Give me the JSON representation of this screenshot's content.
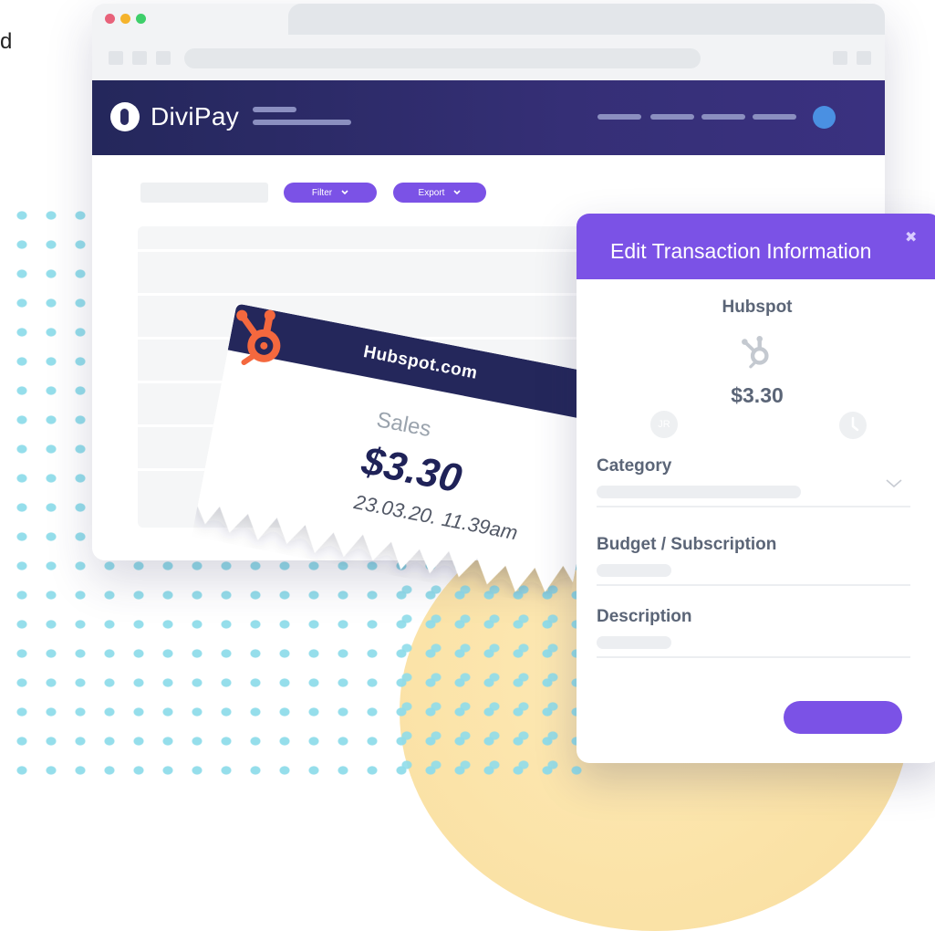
{
  "corner_text": "d",
  "colors": {
    "purple": "#7b52e6",
    "navy": "#24275b",
    "hubspot_orange": "#f4683e",
    "dot_cyan": "#8fdcea"
  },
  "window": {
    "traffic_lights": [
      "#e8627a",
      "#f5b32c",
      "#3ecf6a"
    ]
  },
  "navbar": {
    "brand": "DiviPay",
    "logo_icon": "keyhole-logo-icon",
    "avatar_color": "#4a90e2"
  },
  "toolbar": {
    "filter_label": "Filter",
    "export_label": "Export",
    "dropdown_icon": "chevron-down-icon"
  },
  "receipt": {
    "merchant_site": "Hubspot.com",
    "category": "Sales",
    "amount": "$3.30",
    "datetime": "23.03.20. 11.39am",
    "logo_icon": "hubspot-sprocket-icon"
  },
  "modal": {
    "title": "Edit Transaction Information",
    "close_icon": "close-icon",
    "merchant": "Hubspot",
    "amount": "$3.30",
    "avatar_initials": "JR",
    "fields": [
      {
        "label": "Category"
      },
      {
        "label": "Budget / Subscription"
      },
      {
        "label": "Description"
      }
    ]
  }
}
